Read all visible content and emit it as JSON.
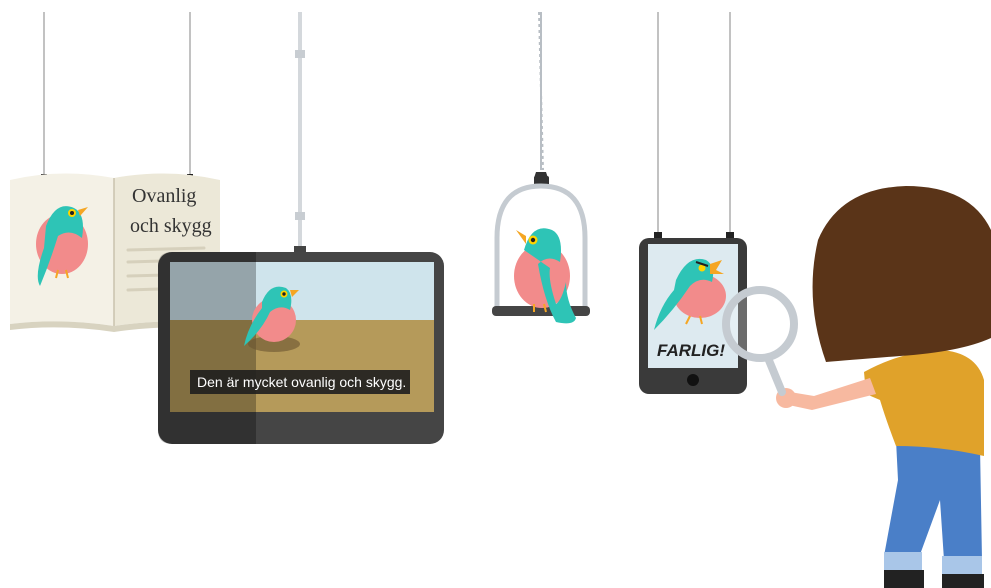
{
  "book": {
    "title_line1": "Ovanlig",
    "title_line2": "och skygg"
  },
  "tv": {
    "subtitle": "Den är mycket ovanlig och skygg."
  },
  "phone": {
    "warning": "FARLIG!"
  },
  "colors": {
    "bird_body": "#F28B8B",
    "bird_wing": "#2EC4B6",
    "bird_beak": "#F5A623",
    "hair": "#5A3418",
    "shirt": "#E0A22A",
    "jeans": "#4A7FC8",
    "device_frame": "#333333"
  },
  "icons": {
    "magnifier": "magnifying-glass-icon",
    "cage": "birdcage-icon"
  }
}
